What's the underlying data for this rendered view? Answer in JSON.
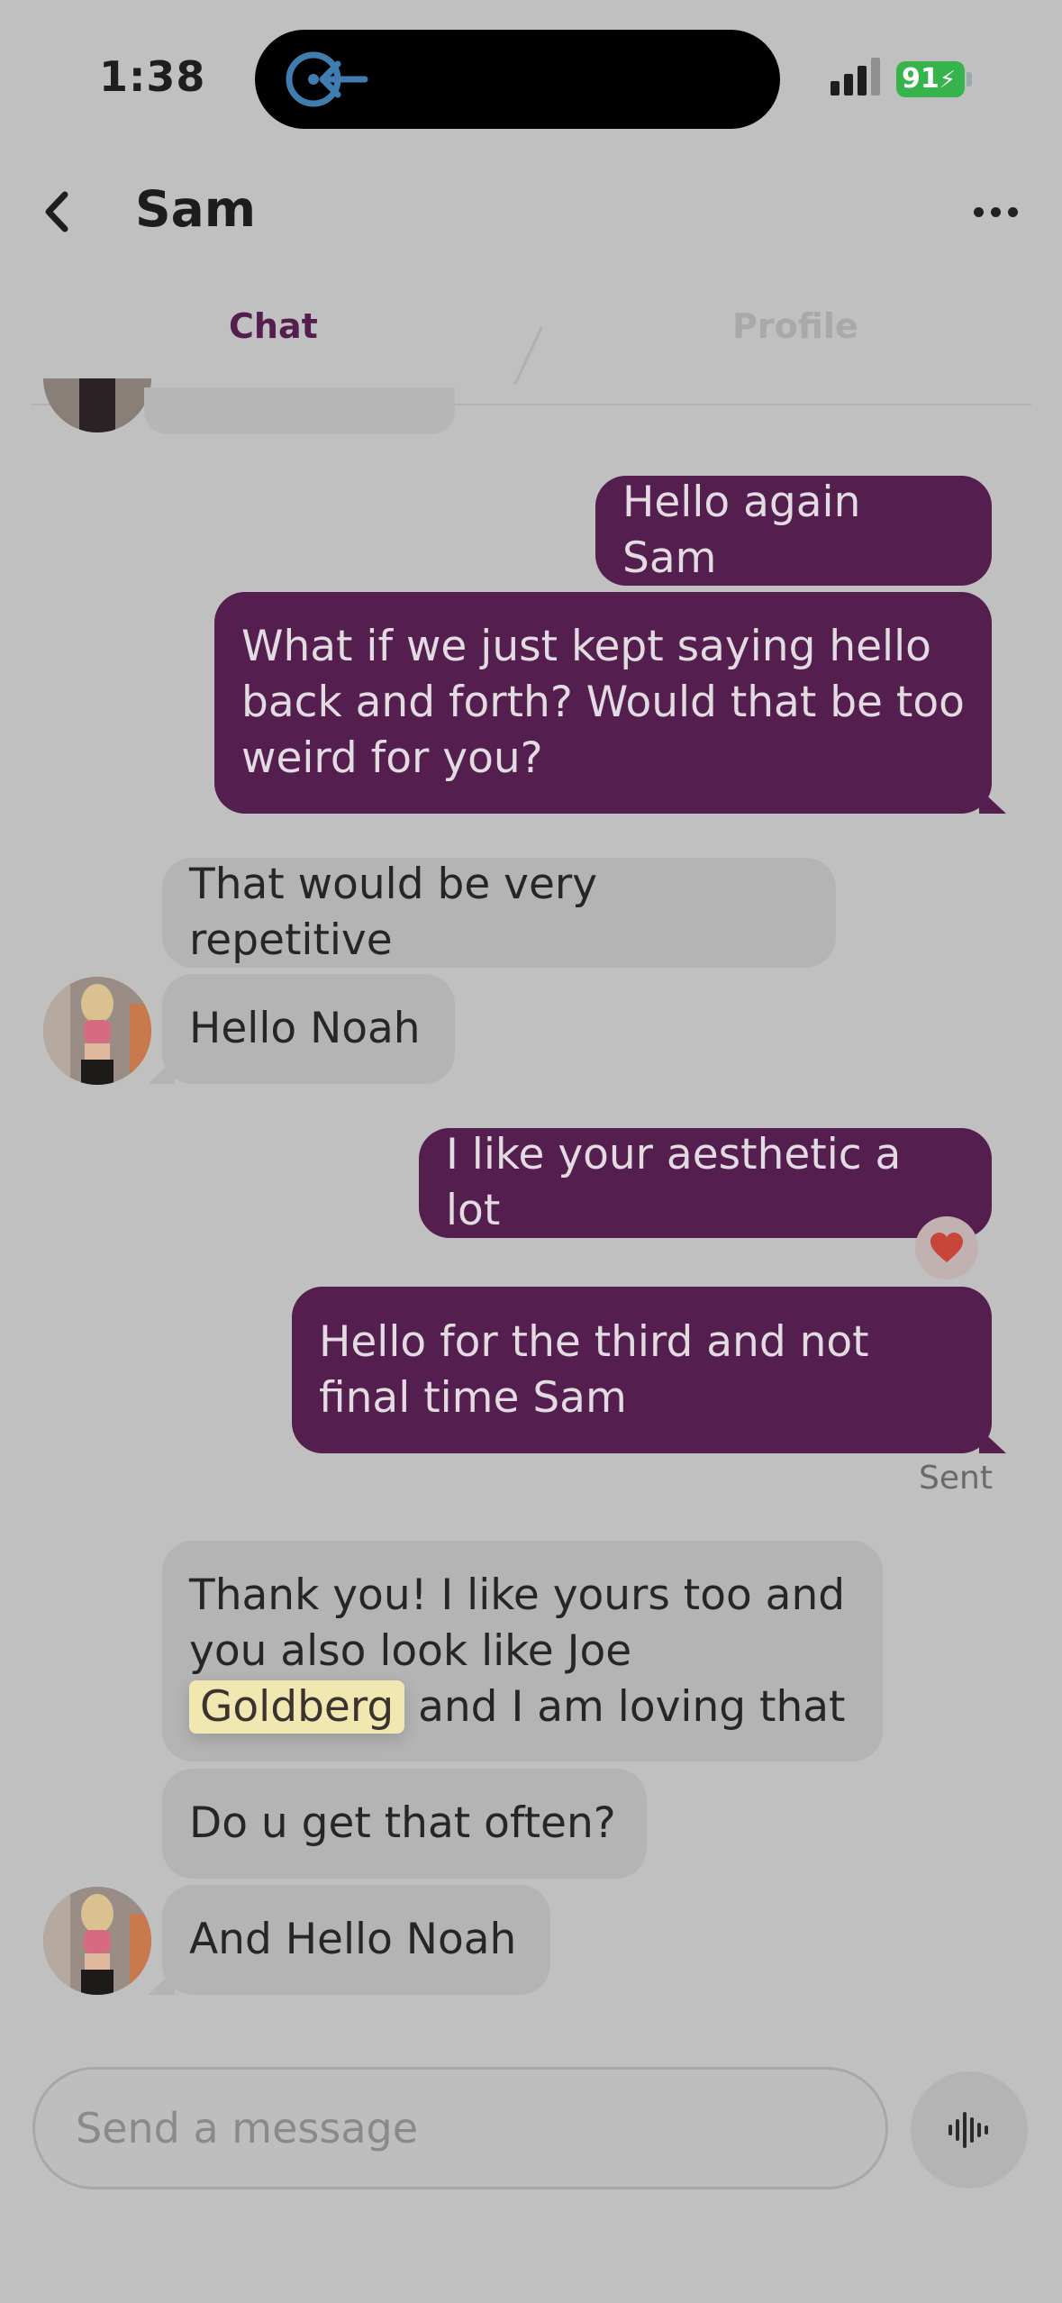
{
  "status_bar": {
    "time": "1:38",
    "battery": "91"
  },
  "header": {
    "title": "Sam",
    "back_icon": "chevron-left-icon",
    "more_icon": "more-horizontal-icon"
  },
  "tabs": [
    {
      "label": "Chat",
      "active": true
    },
    {
      "label": "Profile",
      "active": false
    }
  ],
  "messages": [
    {
      "direction": "out",
      "text": "Hello again Sam"
    },
    {
      "direction": "out",
      "text": "What if we just kept saying hello back and forth? Would that be too weird for you?"
    },
    {
      "direction": "in",
      "text": "That would be very repetitive"
    },
    {
      "direction": "in",
      "text": "Hello Noah"
    },
    {
      "direction": "out",
      "text": "I like your aesthetic a lot",
      "reaction": "heart-icon"
    },
    {
      "direction": "out",
      "text": "Hello for the third and not final time Sam",
      "status": "Sent"
    },
    {
      "direction": "in",
      "text_before": "Thank you! I like yours too and you also look like Joe ",
      "highlight": "Goldberg",
      "text_after": " and I am loving that"
    },
    {
      "direction": "in",
      "text": "Do u get that often?"
    },
    {
      "direction": "in",
      "text": "And Hello Noah"
    }
  ],
  "composer": {
    "placeholder": "Send a message",
    "voice_icon": "voice-waveform-icon"
  },
  "colors": {
    "accent": "#541e4e",
    "background": "#c0c0c0",
    "incoming_bubble": "#b4b4b4",
    "reaction_heart": "#c8453a",
    "highlight": "#f0e8b0"
  }
}
